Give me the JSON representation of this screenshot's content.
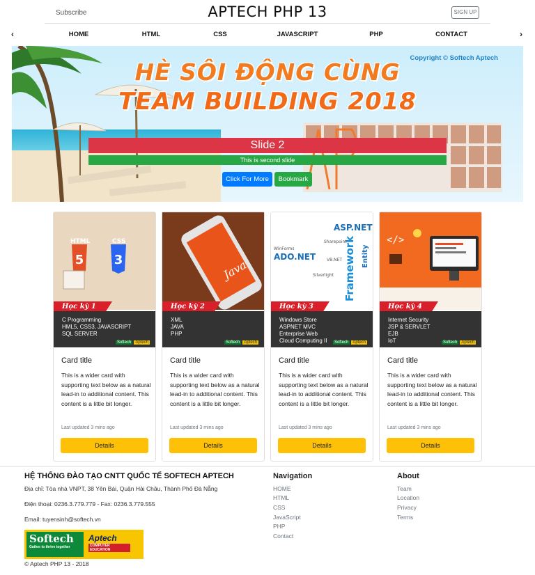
{
  "header": {
    "subscribe": "Subscribe",
    "brand": "APTECH PHP 13",
    "signup": "SIGN UP"
  },
  "nav": {
    "prev": "‹",
    "next": "›",
    "items": [
      "HOME",
      "HTML",
      "CSS",
      "JAVASCRIPT",
      "PHP",
      "CONTACT"
    ]
  },
  "hero": {
    "copyright": "Copyright © Softech Aptech",
    "title_line1": "HÈ SÔI ĐỘNG CÙNG",
    "title_line2": "TEAM BUILDING 2018",
    "slide_title": "Slide 2",
    "slide_subtitle": "This is second slide",
    "button_more": "Click For More",
    "button_bookmark": "Bookmark",
    "colors": {
      "slide_title_bg": "#dc3545",
      "slide_sub_bg": "#28a745",
      "more_bg": "#007bff"
    }
  },
  "cards": [
    {
      "term": "Học kỳ 1",
      "subjects": [
        "C Programming",
        "HML5, CSS3, JAVASCRIPT",
        "SQL SERVER"
      ],
      "title": "Card title",
      "text": "This is a wider card with supporting text below as a natural lead-in to additional content. This content is a little bit longer.",
      "updated": "Last updated 3 mins ago",
      "button": "Details",
      "art": [
        "HTML",
        "CSS"
      ]
    },
    {
      "term": "Học kỳ 2",
      "subjects": [
        "XML",
        "JAVA",
        "PHP"
      ],
      "title": "Card title",
      "text": "This is a wider card with supporting text below as a natural lead-in to additional content. This content is a little bit longer.",
      "updated": "Last updated 3 mins ago",
      "button": "Details",
      "art": [
        "Java"
      ]
    },
    {
      "term": "Học kỳ 3",
      "subjects": [
        "Windows Store",
        "ASPNET MVC",
        "Enterprise Web",
        "Cloud Computing II"
      ],
      "title": "Card title",
      "text": "This is a wider card with supporting text below as a natural lead-in to additional content. This content is a little bit longer.",
      "updated": "Last updated 3 mins ago",
      "button": "Details",
      "art": [
        "ASP.NET",
        "ADO.NET",
        "Framework",
        "Entity",
        "WinForms",
        "Sharepoint",
        "VB.NET",
        "Silverlight"
      ]
    },
    {
      "term": "Học kỳ 4",
      "subjects": [
        "Internet Security",
        "JSP & SERVLET",
        "EJB",
        "IoT"
      ],
      "title": "Card title",
      "text": "This is a wider card with supporting text below as a natural lead-in to additional content. This content is a little bit longer.",
      "updated": "Last updated 3 mins ago",
      "button": "Details",
      "art": [
        "</>"
      ]
    }
  ],
  "card_logos": {
    "softech": "Softech",
    "aptech": "Aptech"
  },
  "footer": {
    "heading": "HỆ THỐNG ĐÀO TẠO CNTT QUỐC TẾ SOFTECH APTECH",
    "address": "Địa chỉ: Tòa nhà VNPT, 38 Yên Bái, Quận Hải Châu, Thành Phố Đà Nẵng",
    "phone": "Điện thoại: 0236.3.779.779 - Fax: 0236.3.779.555",
    "email": "Email: tuyensinh@softech.vn",
    "logo": {
      "softech": "Softech",
      "softech_tag": "Gather to thrive together",
      "aptech": "Aptech",
      "aptech_tag": "COMPUTER EDUCATION"
    },
    "copyright": "© Aptech PHP 13 - 2018",
    "navigation": {
      "title": "Navigation",
      "links": [
        "HOME",
        "HTML",
        "CSS",
        "JavaScript",
        "PHP",
        "Contact"
      ]
    },
    "about": {
      "title": "About",
      "links": [
        "Team",
        "Location",
        "Privacy",
        "Terms"
      ]
    }
  }
}
